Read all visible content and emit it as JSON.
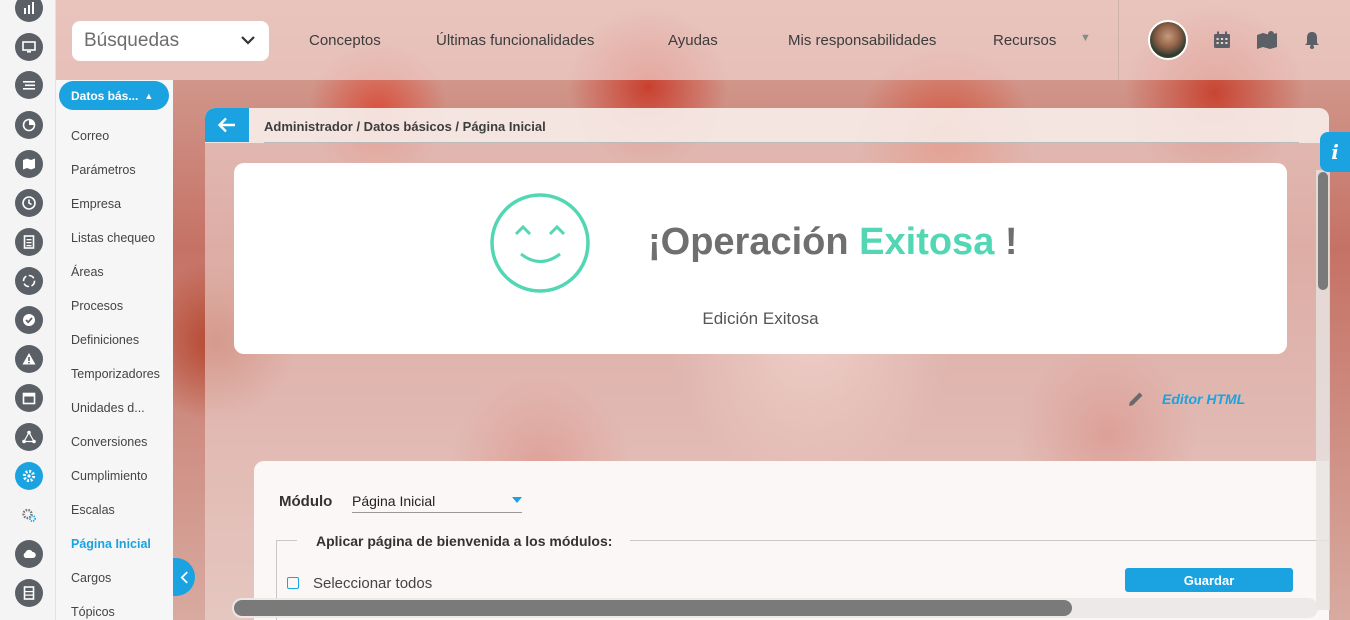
{
  "search": {
    "label": "Búsquedas"
  },
  "nav": [
    "Conceptos",
    "Últimas funcionalidades",
    "Ayudas",
    "Mis responsabilidades",
    "Recursos"
  ],
  "sidebar": {
    "section": "Datos bás...",
    "items": [
      "Correo",
      "Parámetros",
      "Empresa",
      "Listas chequeo",
      "Áreas",
      "Procesos",
      "Definiciones",
      "Temporizadores",
      "Unidades d...",
      "Conversiones",
      "Cumplimiento",
      "Escalas",
      "Página Inicial",
      "Cargos",
      "Tópicos"
    ],
    "active_item": "Página Inicial"
  },
  "breadcrumb": "Administrador / Datos básicos / Página Inicial",
  "success": {
    "title_prefix": "¡Operación ",
    "title_accent": "Exitosa",
    "title_suffix": " !",
    "subtitle": "Edición Exitosa"
  },
  "editor_link": "Editor HTML",
  "form": {
    "modulo_label": "Módulo",
    "modulo_value": "Página Inicial",
    "fieldset_title": "Aplicar página de bienvenida a los módulos:",
    "select_all_label": "Seleccionar todos",
    "save_label": "Guardar"
  },
  "info_tab": "i",
  "colors": {
    "accent": "#1aa3e0",
    "success": "#52d6b3"
  }
}
